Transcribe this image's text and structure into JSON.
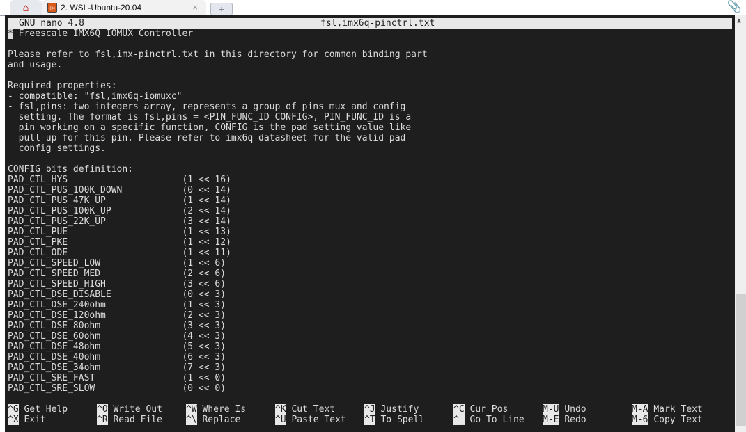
{
  "tabs": {
    "home_icon": "home-icon",
    "active_tab": "2. WSL-Ubuntu-20.04",
    "close": "×",
    "new_tab": "+"
  },
  "nano": {
    "version": "GNU nano 4.8",
    "filename": "fsl,imx6q-pinctrl.txt",
    "cursor_char": "*",
    "lines": [
      " Freescale IMX6Q IOMUX Controller",
      "",
      "Please refer to fsl,imx-pinctrl.txt in this directory for common binding part",
      "and usage.",
      "",
      "Required properties:",
      "- compatible: \"fsl,imx6q-iomuxc\"",
      "- fsl,pins: two integers array, represents a group of pins mux and config",
      "  setting. The format is fsl,pins = <PIN_FUNC_ID CONFIG>, PIN_FUNC_ID is a",
      "  pin working on a specific function, CONFIG is the pad setting value like",
      "  pull-up for this pin. Please refer to imx6q datasheet for the valid pad",
      "  config settings.",
      "",
      "CONFIG bits definition:",
      "PAD_CTL_HYS                     (1 << 16)",
      "PAD_CTL_PUS_100K_DOWN           (0 << 14)",
      "PAD_CTL_PUS_47K_UP              (1 << 14)",
      "PAD_CTL_PUS_100K_UP             (2 << 14)",
      "PAD_CTL_PUS_22K_UP              (3 << 14)",
      "PAD_CTL_PUE                     (1 << 13)",
      "PAD_CTL_PKE                     (1 << 12)",
      "PAD_CTL_ODE                     (1 << 11)",
      "PAD_CTL_SPEED_LOW               (1 << 6)",
      "PAD_CTL_SPEED_MED               (2 << 6)",
      "PAD_CTL_SPEED_HIGH              (3 << 6)",
      "PAD_CTL_DSE_DISABLE             (0 << 3)",
      "PAD_CTL_DSE_240ohm              (1 << 3)",
      "PAD_CTL_DSE_120ohm              (2 << 3)",
      "PAD_CTL_DSE_80ohm               (3 << 3)",
      "PAD_CTL_DSE_60ohm               (4 << 3)",
      "PAD_CTL_DSE_48ohm               (5 << 3)",
      "PAD_CTL_DSE_40ohm               (6 << 3)",
      "PAD_CTL_DSE_34ohm               (7 << 3)",
      "PAD_CTL_SRE_FAST                (1 << 0)",
      "PAD_CTL_SRE_SLOW                (0 << 0)"
    ],
    "shortcuts": [
      {
        "key": "^G",
        "label": "Get Help"
      },
      {
        "key": "^X",
        "label": "Exit"
      },
      {
        "key": "^O",
        "label": "Write Out"
      },
      {
        "key": "^R",
        "label": "Read File"
      },
      {
        "key": "^W",
        "label": "Where Is"
      },
      {
        "key": "^\\",
        "label": "Replace"
      },
      {
        "key": "^K",
        "label": "Cut Text"
      },
      {
        "key": "^U",
        "label": "Paste Text"
      },
      {
        "key": "^J",
        "label": "Justify"
      },
      {
        "key": "^T",
        "label": "To Spell"
      },
      {
        "key": "^C",
        "label": "Cur Pos"
      },
      {
        "key": "^_",
        "label": "Go To Line"
      },
      {
        "key": "M-U",
        "label": "Undo"
      },
      {
        "key": "M-E",
        "label": "Redo"
      },
      {
        "key": "M-A",
        "label": "Mark Text"
      },
      {
        "key": "M-6",
        "label": "Copy Text"
      }
    ]
  }
}
